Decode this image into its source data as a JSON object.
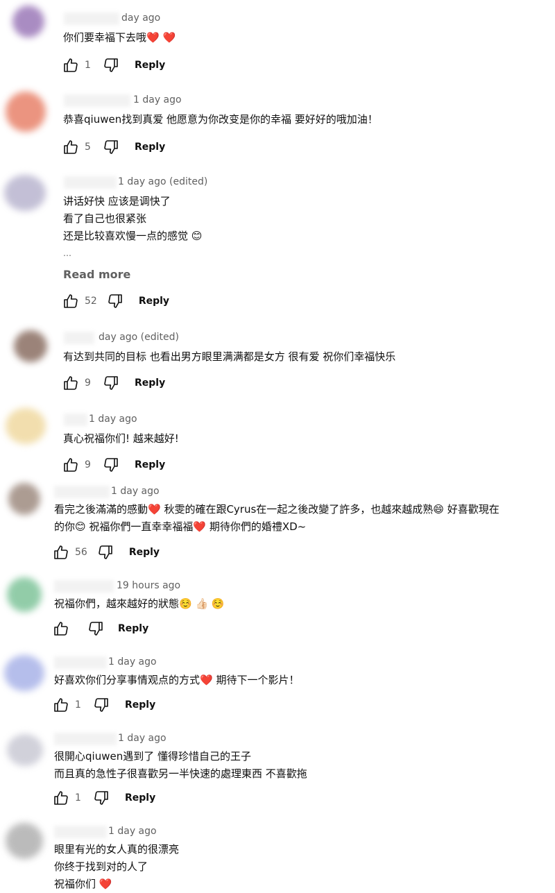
{
  "comments": [
    {
      "meta": "day ago",
      "lines": [
        "你们要幸福下去哦❤️ ❤️"
      ],
      "likes": "1",
      "reply": "Reply",
      "avatar_color": "#9b78b8"
    },
    {
      "meta": "1 day ago",
      "lines": [
        "恭喜qiuwen找到真爱 他愿意为你改变是你的幸福 要好好的哦加油！"
      ],
      "likes": "5",
      "reply": "Reply",
      "avatar_color": "#e8826a"
    },
    {
      "meta": "1 day ago (edited)",
      "lines": [
        "讲话好快 应该是调快了",
        "看了自己也很紧张",
        "还是比较喜欢慢一点的感觉 😊"
      ],
      "ellipsis": "…",
      "read_more": "Read more",
      "likes": "52",
      "reply": "Reply",
      "avatar_color": "#b9b5cf"
    },
    {
      "meta": "day ago (edited)",
      "lines": [
        "有达到共同的目标 也看出男方眼里满满都是女方 很有爱 祝你们幸福快乐"
      ],
      "likes": "9",
      "reply": "Reply",
      "avatar_color": "#8a6e62"
    },
    {
      "meta": "1 day ago",
      "lines": [
        "真心祝福你们! 越来越好!"
      ],
      "likes": "9",
      "reply": "Reply",
      "avatar_color": "#f0d9a0"
    },
    {
      "meta": "1 day ago",
      "lines": [
        "看完之後滿滿的感動❤️ 秋雯的確在跟Cyrus在一起之後改變了許多，也越來越成熟😄 好喜歡現在",
        "的你😊 祝福你們一直幸幸福福❤️ 期待你們的婚禮XD~"
      ],
      "likes": "56",
      "reply": "Reply",
      "avatar_color": "#9e8b80"
    },
    {
      "meta": "19 hours ago",
      "lines": [
        "祝福你們，越來越好的狀態☺️ 👍🏻 ☺️"
      ],
      "likes": "",
      "reply": "Reply",
      "avatar_color": "#7fc49a"
    },
    {
      "meta": "1 day ago",
      "lines": [
        "好喜欢你们分享事情观点的方式❤️ 期待下一个影片！"
      ],
      "likes": "1",
      "reply": "Reply",
      "avatar_color": "#a9b3e8"
    },
    {
      "meta": "1 day ago",
      "lines": [
        "很開心qiuwen遇到了 懂得珍惜自己的王子",
        "而且真的急性子很喜歡另一半快速的處理東西 不喜歡拖"
      ],
      "likes": "1",
      "reply": "Reply",
      "avatar_color": "#c9c9d4"
    },
    {
      "meta": "1 day ago",
      "lines": [
        "眼里有光的女人真的很漂亮",
        "你终于找到对的人了",
        "祝福你们 ❤️"
      ],
      "avatar_color": "#b0b0b0"
    }
  ]
}
